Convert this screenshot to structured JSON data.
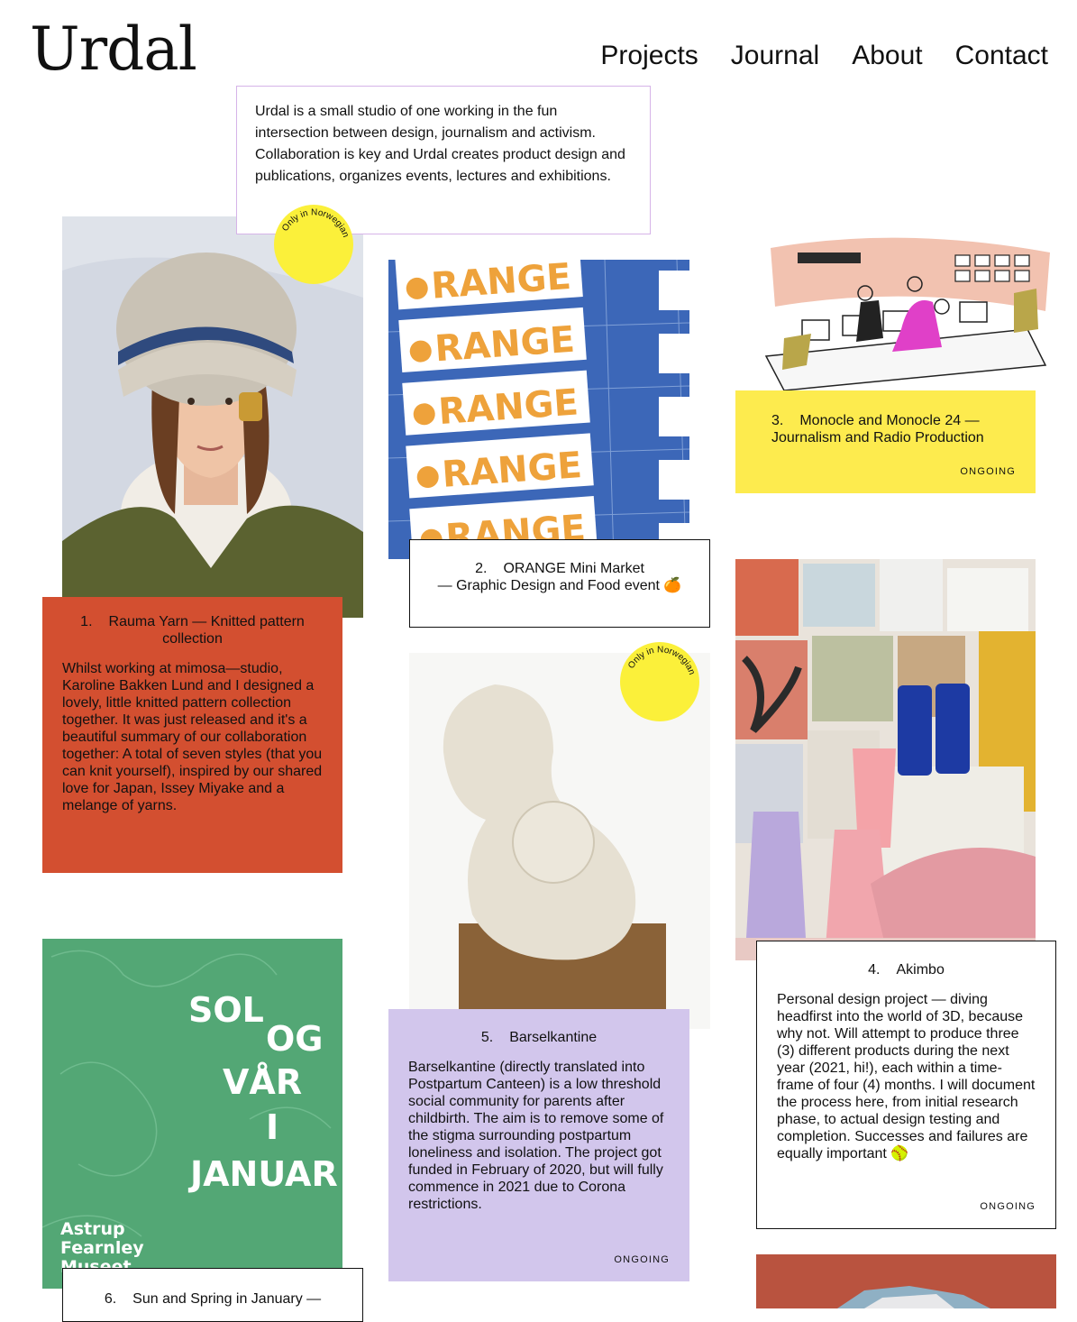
{
  "site": {
    "logo": "Urdal"
  },
  "nav": {
    "items": [
      "Projects",
      "Journal",
      "About",
      "Contact"
    ]
  },
  "intro": {
    "text": "Urdal is a small studio of one working in the fun intersection between design, journalism and activism. Collaboration is key and Urdal creates product design and publications, organizes events, lectures and exhibitions."
  },
  "badge_label": "Only in Norwegian",
  "colors": {
    "red": "#d34f30",
    "yellow": "#fdeb4e",
    "lilac": "#d2c6ec",
    "green": "#53a775",
    "badge": "#fbf03a",
    "orange_blue": "#3c67b8"
  },
  "projects": [
    {
      "num": "1.",
      "title": "Rauma Yarn — Knitted pattern collection",
      "text": "Whilst working at mimosa—studio, Karoline Bakken Lund and I designed a lovely, little knitted pattern collection together. It was just released and it's a beautiful summary of our collaboration together: A total of seven styles (that you can knit yourself), inspired by our shared love for Japan, Issey Miyake and a melange of yarns."
    },
    {
      "num": "2.",
      "title_line1": "ORANGE Mini Market",
      "title_line2": "— Graphic Design and Food event 🍊"
    },
    {
      "num": "3.",
      "title_line1": "Monocle and Monocle 24 —",
      "title_line2": "Journalism and Radio Production",
      "status": "ONGOING"
    },
    {
      "num": "4.",
      "title": "Akimbo",
      "text": "Personal design project — diving headfirst into the world of 3D, because why not. Will attempt to produce three (3) different products during the next year (2021, hi!), each within a time-frame of four (4) months. I will document the process here, from initial research phase, to actual design testing and completion. Successes and failures are equally important 🥎",
      "status": "ONGOING"
    },
    {
      "num": "5.",
      "title": "Barselkantine",
      "text": "Barselkantine (directly translated into Postpartum Canteen) is a low threshold social community for parents after childbirth. The aim is to remove some of the stigma surrounding postpartum loneliness and isolation. The project got funded in February of 2020, but will fully commence in 2021 due to Corona restrictions.",
      "status": "ONGOING"
    },
    {
      "num": "6.",
      "title": "Sun and Spring in January —"
    }
  ],
  "poster_orange": {
    "word": "ORANGE"
  },
  "poster_sol": {
    "lines": [
      "SOL",
      "OG",
      "VÅR",
      "I",
      "JANUAR"
    ],
    "museum": [
      "Astrup",
      "Fearnley",
      "Museet"
    ]
  }
}
